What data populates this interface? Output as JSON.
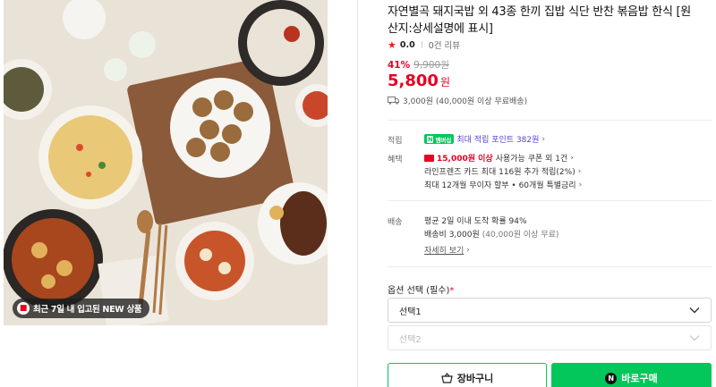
{
  "image": {
    "badge_text": "최근 7일 내 입고된 NEW 상품"
  },
  "product": {
    "title": "자연별곡 돼지국밥 외 43종 한끼 집밥 식단 반찬 볶음밥 한식 [원산지:상세설명에 표시]",
    "rating": "0.0",
    "reviews": "0건 리뷰",
    "discount": "41%",
    "original_price": "9,900원",
    "price": "5,800",
    "price_unit": "원",
    "shipping": "3,000원 (40,000원 이상 무료배송)"
  },
  "benefits": {
    "points_label": "적립",
    "npay_badge": "멤버십",
    "points_text": "최대 적립 포인트 382원",
    "benefit_label": "혜택",
    "coupon_strong": "15,000원 이상",
    "coupon_text": "사용가능 쿠폰 외 1건",
    "card_point": "라인프렌즈 카드 최대 116원 추가 적립(2%)",
    "installment": "최대 12개월 무이자 할부 • 60개월 특별금리"
  },
  "delivery": {
    "label": "배송",
    "arrival": "평균 2일 이내 도착 확률 94%",
    "fee": "배송비 3,000원",
    "fee_note": "(40,000원 이상 무료)",
    "more_link": "자세히 보기"
  },
  "options": {
    "label": "옵션 선택 (필수)",
    "required_mark": "*",
    "select1": "선택1",
    "select2": "선택2"
  },
  "buttons": {
    "cart": "장바구니",
    "buy": "바로구매",
    "buy_icon_text": "N"
  },
  "colors": {
    "accent_red": "#e60023",
    "naver_green": "#03c75a",
    "point_purple": "#5b40d8"
  }
}
